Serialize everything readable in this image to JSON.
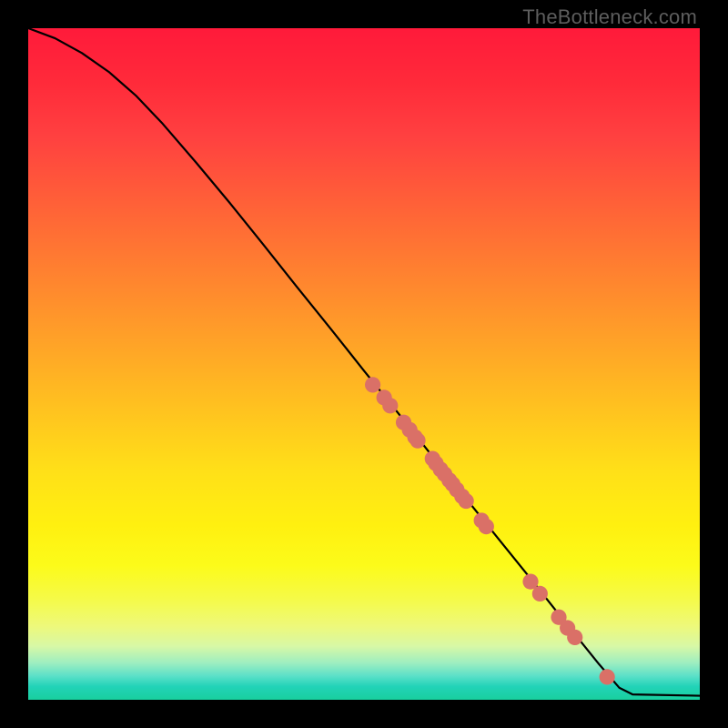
{
  "watermark": "TheBottleneck.com",
  "colors": {
    "marker": "#da7067",
    "curve": "#000000",
    "background": "#000000"
  },
  "chart_data": {
    "type": "line",
    "title": "",
    "xlabel": "",
    "ylabel": "",
    "xlim": [
      0,
      100
    ],
    "ylim": [
      0,
      100
    ],
    "grid": false,
    "gradient": "red-yellow-green vertical (high=red, low=green)",
    "curve_comment": "Black curve: starts top-left, decreases roughly linearly, flattens to ~0 near x≈90 then runs flat to x=100. Values below are (x, y) with y on 0-100 scale (100 at top).",
    "curve": [
      [
        0,
        100
      ],
      [
        4,
        98.5
      ],
      [
        8,
        96.3
      ],
      [
        12,
        93.5
      ],
      [
        16,
        90.0
      ],
      [
        20,
        85.8
      ],
      [
        25,
        80.0
      ],
      [
        30,
        74.0
      ],
      [
        35,
        67.8
      ],
      [
        40,
        61.5
      ],
      [
        45,
        55.3
      ],
      [
        50,
        49.0
      ],
      [
        55,
        42.8
      ],
      [
        60,
        36.5
      ],
      [
        65,
        30.2
      ],
      [
        70,
        24.0
      ],
      [
        75,
        17.8
      ],
      [
        80,
        11.5
      ],
      [
        85,
        5.3
      ],
      [
        88,
        1.8
      ],
      [
        90,
        0.8
      ],
      [
        100,
        0.6
      ]
    ],
    "markers_comment": "Salmon dots along the curve; clustered mid-curve and a sparser group lower-right.",
    "markers": [
      {
        "x": 51.3,
        "y": 46.9
      },
      {
        "x": 53.0,
        "y": 45.0
      },
      {
        "x": 53.9,
        "y": 43.8
      },
      {
        "x": 55.9,
        "y": 41.3
      },
      {
        "x": 56.8,
        "y": 40.2
      },
      {
        "x": 57.6,
        "y": 39.1
      },
      {
        "x": 58.0,
        "y": 38.6
      },
      {
        "x": 60.2,
        "y": 35.9
      },
      {
        "x": 60.7,
        "y": 35.2
      },
      {
        "x": 61.4,
        "y": 34.3
      },
      {
        "x": 62.0,
        "y": 33.6
      },
      {
        "x": 62.7,
        "y": 32.7
      },
      {
        "x": 63.2,
        "y": 32.1
      },
      {
        "x": 63.8,
        "y": 31.3
      },
      {
        "x": 64.6,
        "y": 30.3
      },
      {
        "x": 65.2,
        "y": 29.6
      },
      {
        "x": 67.5,
        "y": 26.7
      },
      {
        "x": 68.2,
        "y": 25.8
      },
      {
        "x": 74.8,
        "y": 17.6
      },
      {
        "x": 76.2,
        "y": 15.8
      },
      {
        "x": 79.0,
        "y": 12.3
      },
      {
        "x": 80.3,
        "y": 10.7
      },
      {
        "x": 81.4,
        "y": 9.3
      },
      {
        "x": 86.2,
        "y": 3.4
      }
    ]
  }
}
